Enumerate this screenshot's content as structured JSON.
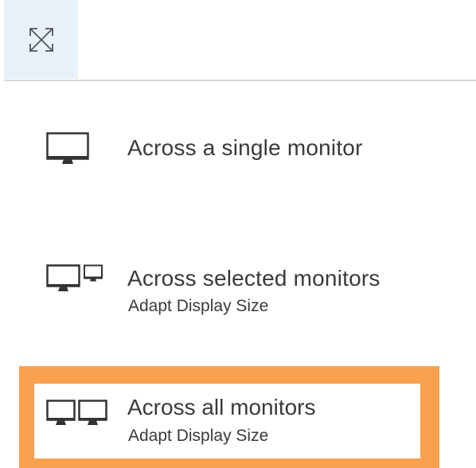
{
  "toolbar": {
    "fullscreen_icon": "expand-arrows-icon"
  },
  "menu": {
    "items": [
      {
        "icon": "single-monitor-icon",
        "title": "Across a single monitor",
        "subtitle": ""
      },
      {
        "icon": "selected-monitors-icon",
        "title": "Across selected monitors",
        "subtitle": "Adapt Display Size"
      },
      {
        "icon": "all-monitors-icon",
        "title": "Across all monitors",
        "subtitle": "Adapt Display Size",
        "highlighted": true
      }
    ]
  },
  "colors": {
    "highlight": "#f9a14e",
    "button_bg": "#e8f1f8",
    "text": "#3a3a3a"
  }
}
